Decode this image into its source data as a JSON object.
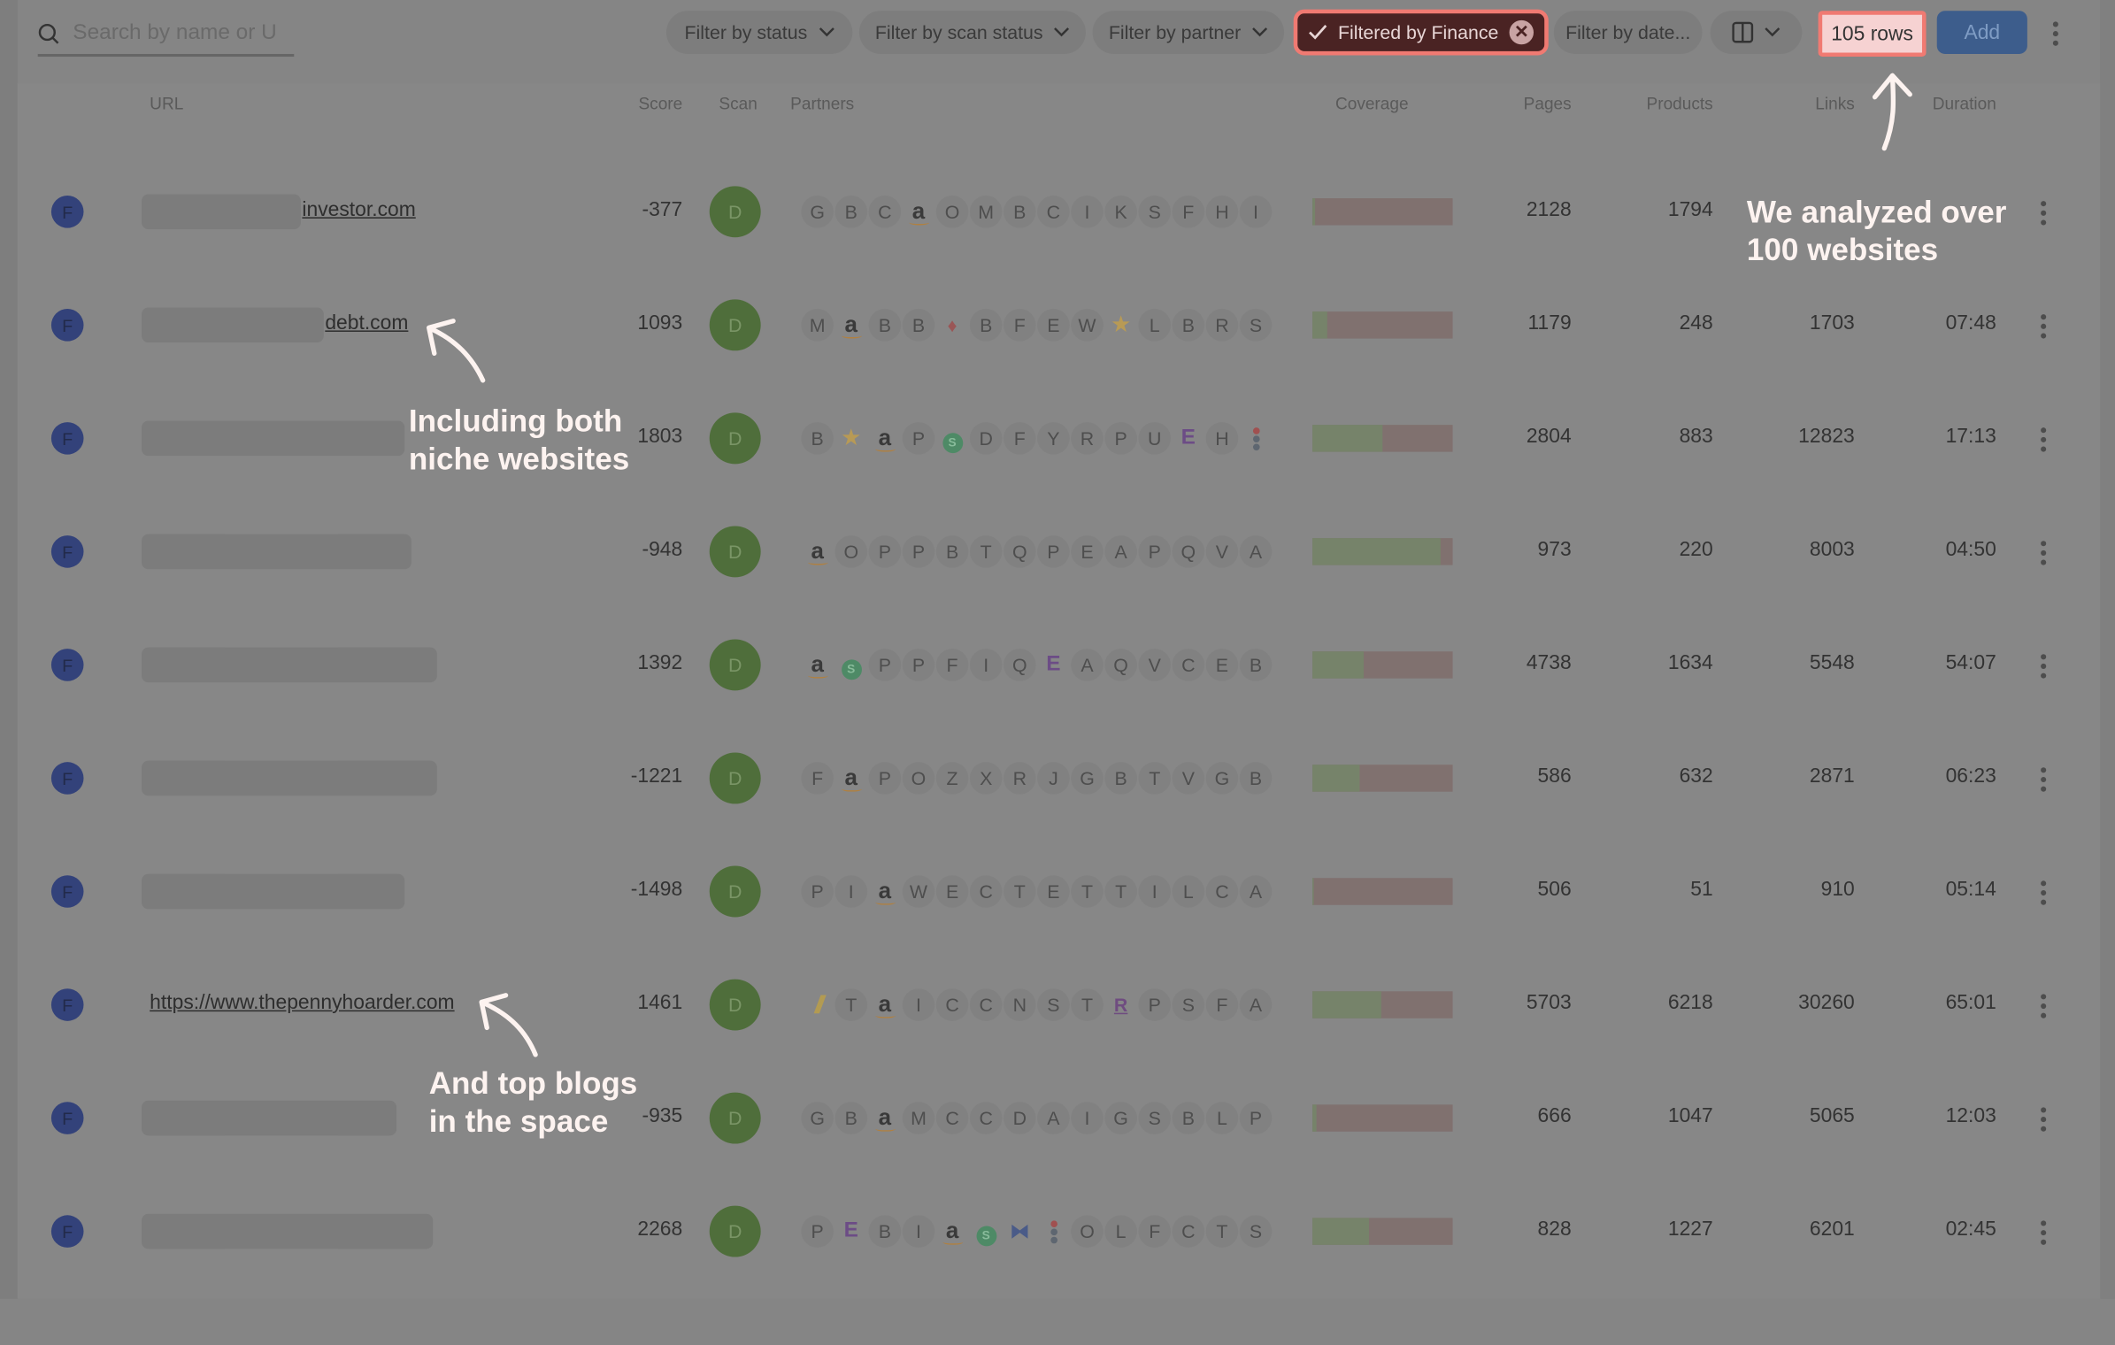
{
  "toolbar": {
    "search_placeholder": "Search by name or U",
    "filters": [
      "Filter by status",
      "Filter by scan status",
      "Filter by partner"
    ],
    "active_filter": "Filtered by Finance",
    "date_filter": "Filter by date...",
    "row_count": "105 rows",
    "add_label": "Add"
  },
  "columns": {
    "url": "URL",
    "score": "Score",
    "scan": "Scan",
    "partners": "Partners",
    "coverage": "Coverage",
    "pages": "Pages",
    "products": "Products",
    "links": "Links",
    "duration": "Duration"
  },
  "colors": {
    "accent_red": "#f07a72",
    "active_filter_bg": "#4a2323",
    "add_button": "#3d5d8c",
    "avatar": "#33427a",
    "scan_badge": "#4f6e3b",
    "coverage_good": "#76836a",
    "coverage_bad": "#80716f"
  },
  "rows": [
    {
      "avatar": "F",
      "url": "investor.com",
      "score": "-377",
      "scan": "D",
      "partners": [
        "G",
        "B",
        "C",
        "amazon",
        "O",
        "M",
        "B",
        "C",
        "I",
        "K",
        "S",
        "F",
        "H",
        "I"
      ],
      "coverage": 0.02,
      "pages": "2128",
      "products": "1794",
      "links": "",
      "duration": ""
    },
    {
      "avatar": "F",
      "url": "debt.com",
      "score": "1093",
      "scan": "D",
      "partners": [
        "M",
        "amazon",
        "B",
        "B",
        "flame",
        "B",
        "F",
        "E",
        "W",
        "star",
        "L",
        "B",
        "R",
        "S"
      ],
      "coverage": 0.11,
      "pages": "1179",
      "products": "248",
      "links": "1703",
      "duration": "07:48"
    },
    {
      "avatar": "F",
      "url": "",
      "score": "1803",
      "scan": "D",
      "partners": [
        "B",
        "star",
        "amazon",
        "P",
        "sg",
        "D",
        "F",
        "Y",
        "R",
        "P",
        "U",
        "elogo",
        "H",
        "dots"
      ],
      "coverage": 0.5,
      "pages": "2804",
      "products": "883",
      "links": "12823",
      "duration": "17:13"
    },
    {
      "avatar": "F",
      "url": "",
      "score": "-948",
      "scan": "D",
      "partners": [
        "amazon",
        "O",
        "P",
        "P",
        "B",
        "T",
        "Q",
        "P",
        "E",
        "A",
        "P",
        "Q",
        "V",
        "A"
      ],
      "coverage": 0.91,
      "pages": "973",
      "products": "220",
      "links": "8003",
      "duration": "04:50"
    },
    {
      "avatar": "F",
      "url": "",
      "score": "1392",
      "scan": "D",
      "partners": [
        "amazon",
        "sg",
        "P",
        "P",
        "F",
        "I",
        "Q",
        "elogo",
        "A",
        "Q",
        "V",
        "C",
        "E",
        "B"
      ],
      "coverage": 0.37,
      "pages": "4738",
      "products": "1634",
      "links": "5548",
      "duration": "54:07"
    },
    {
      "avatar": "F",
      "url": "",
      "score": "-1221",
      "scan": "D",
      "partners": [
        "F",
        "amazon",
        "P",
        "O",
        "Z",
        "X",
        "R",
        "J",
        "G",
        "B",
        "T",
        "V",
        "G",
        "B"
      ],
      "coverage": 0.34,
      "pages": "586",
      "products": "632",
      "links": "2871",
      "duration": "06:23"
    },
    {
      "avatar": "F",
      "url": "",
      "score": "-1498",
      "scan": "D",
      "partners": [
        "P",
        "I",
        "amazon",
        "W",
        "E",
        "C",
        "T",
        "E",
        "T",
        "T",
        "I",
        "L",
        "C",
        "A"
      ],
      "coverage": 0.01,
      "pages": "506",
      "products": "51",
      "links": "910",
      "duration": "05:14"
    },
    {
      "avatar": "F",
      "url": "https://www.thepennyhoarder.com",
      "score": "1461",
      "scan": "D",
      "partners": [
        "slash",
        "T",
        "amazon",
        "I",
        "C",
        "C",
        "N",
        "S",
        "T",
        "rlogo",
        "P",
        "S",
        "F",
        "A"
      ],
      "coverage": 0.49,
      "pages": "5703",
      "products": "6218",
      "links": "30260",
      "duration": "65:01"
    },
    {
      "avatar": "F",
      "url": "",
      "score": "-935",
      "scan": "D",
      "partners": [
        "G",
        "B",
        "amazon",
        "M",
        "C",
        "C",
        "D",
        "A",
        "I",
        "G",
        "S",
        "B",
        "L",
        "P"
      ],
      "coverage": 0.03,
      "pages": "666",
      "products": "1047",
      "links": "5065",
      "duration": "12:03"
    },
    {
      "avatar": "F",
      "url": "",
      "score": "2268",
      "scan": "D",
      "partners": [
        "P",
        "elogo",
        "B",
        "I",
        "amazon",
        "sg",
        "bow",
        "dots",
        "O",
        "L",
        "F",
        "C",
        "T",
        "S"
      ],
      "coverage": 0.4,
      "pages": "828",
      "products": "1227",
      "links": "6201",
      "duration": "02:45"
    }
  ],
  "annotations": {
    "top_right": [
      "We analyzed over",
      "100 websites"
    ],
    "niche": [
      "Including both",
      "niche websites"
    ],
    "blogs": [
      "And top blogs",
      "in the space"
    ]
  }
}
